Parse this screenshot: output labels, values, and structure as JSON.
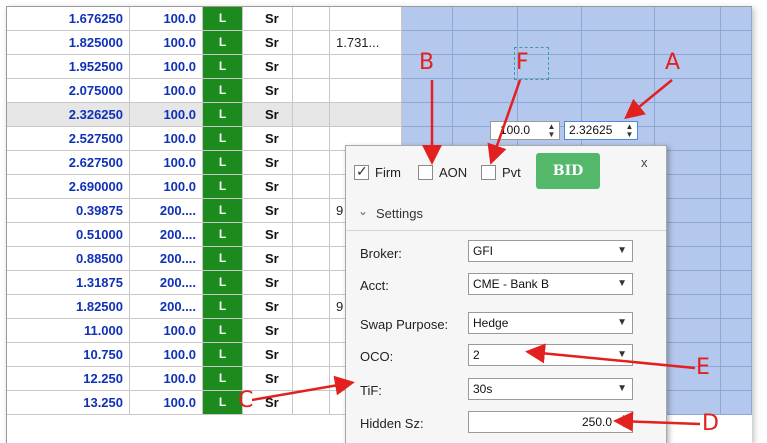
{
  "rows": [
    {
      "price": "1.676250",
      "size": "100.0",
      "flag": "L",
      "side": "Sr",
      "extra": ""
    },
    {
      "price": "1.825000",
      "size": "100.0",
      "flag": "L",
      "side": "Sr",
      "extra": "1.731..."
    },
    {
      "price": "1.952500",
      "size": "100.0",
      "flag": "L",
      "side": "Sr",
      "extra": ""
    },
    {
      "price": "2.075000",
      "size": "100.0",
      "flag": "L",
      "side": "Sr",
      "extra": ""
    },
    {
      "price": "2.326250",
      "size": "100.0",
      "flag": "L",
      "side": "Sr",
      "extra": ""
    },
    {
      "price": "2.527500",
      "size": "100.0",
      "flag": "L",
      "side": "Sr",
      "extra": ""
    },
    {
      "price": "2.627500",
      "size": "100.0",
      "flag": "L",
      "side": "Sr",
      "extra": ""
    },
    {
      "price": "2.690000",
      "size": "100.0",
      "flag": "L",
      "side": "Sr",
      "extra": ""
    },
    {
      "price": "0.39875",
      "size": "200....",
      "flag": "L",
      "side": "Sr",
      "extra": "9"
    },
    {
      "price": "0.51000",
      "size": "200....",
      "flag": "L",
      "side": "Sr",
      "extra": ""
    },
    {
      "price": "0.88500",
      "size": "200....",
      "flag": "L",
      "side": "Sr",
      "extra": ""
    },
    {
      "price": "1.31875",
      "size": "200....",
      "flag": "L",
      "side": "Sr",
      "extra": ""
    },
    {
      "price": "1.82500",
      "size": "200....",
      "flag": "L",
      "side": "Sr",
      "extra": "9"
    },
    {
      "price": "11.000",
      "size": "100.0",
      "flag": "L",
      "side": "Sr",
      "extra": ""
    },
    {
      "price": "10.750",
      "size": "100.0",
      "flag": "L",
      "side": "Sr",
      "extra": ""
    },
    {
      "price": "12.250",
      "size": "100.0",
      "flag": "L",
      "side": "Sr",
      "extra": ""
    },
    {
      "price": "13.250",
      "size": "100.0",
      "flag": "L",
      "side": "Sr",
      "extra": ""
    }
  ],
  "inline_order": {
    "size": "100.0",
    "price": "2.32625"
  },
  "popup": {
    "firm": {
      "label": "Firm",
      "checked": true
    },
    "aon": {
      "label": "AON",
      "checked": false
    },
    "pvt": {
      "label": "Pvt",
      "checked": false
    },
    "bid_label": "BID",
    "close_label": "x",
    "settings_label": "Settings",
    "fields": [
      {
        "label": "Broker:",
        "value": "GFI"
      },
      {
        "label": "Acct:",
        "value": "CME - Bank B"
      },
      {
        "label": "Swap Purpose:",
        "value": "Hedge"
      },
      {
        "label": "OCO:",
        "value": "2"
      },
      {
        "label": "TiF:",
        "value": "30s"
      }
    ],
    "hidden_size": {
      "label": "Hidden Sz:",
      "value": "250.0"
    }
  },
  "annotations": {
    "a": "A",
    "b": "B",
    "c": "C",
    "d": "D",
    "e": "E",
    "f": "F"
  },
  "colors": {
    "flag_green": "#1d8a1d",
    "price_blue": "#1030b8",
    "grid_blue": "#b4c7ec",
    "bid_green": "#54b86a",
    "annotation_red": "#e22020"
  }
}
